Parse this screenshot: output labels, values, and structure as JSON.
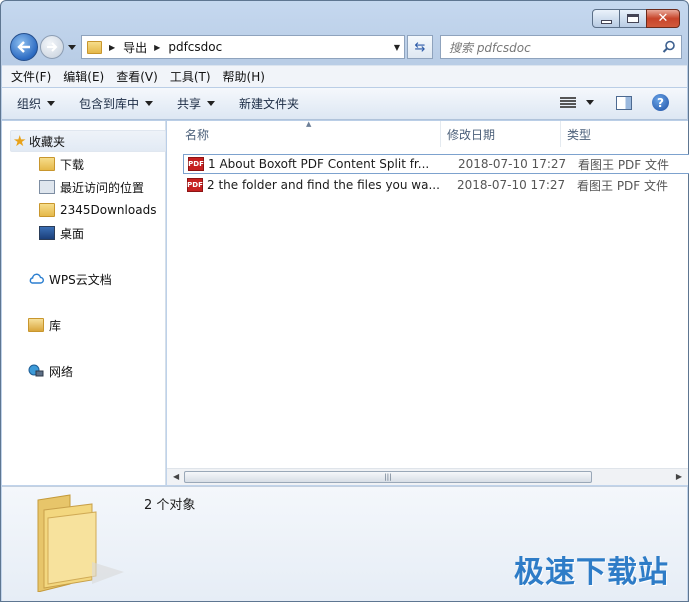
{
  "window": {
    "caption": {
      "minimize": "minimize",
      "maximize": "maximize",
      "close": "close"
    }
  },
  "navigation": {
    "address_parts": [
      "导出",
      "pdfcsdoc"
    ],
    "search_placeholder": "搜索 pdfcsdoc"
  },
  "menubar": {
    "items": [
      "文件(F)",
      "编辑(E)",
      "查看(V)",
      "工具(T)",
      "帮助(H)"
    ]
  },
  "commandbar": {
    "organize": "组织",
    "include_library": "包含到库中",
    "share": "共享",
    "new_folder": "新建文件夹"
  },
  "sidebar": {
    "favorites": "收藏夹",
    "items": [
      {
        "label": "下载",
        "icon": "download-folder-icon"
      },
      {
        "label": "最近访问的位置",
        "icon": "recent-places-icon"
      },
      {
        "label": "2345Downloads",
        "icon": "folder-icon"
      },
      {
        "label": "桌面",
        "icon": "desktop-icon"
      }
    ],
    "wps_cloud": "WPS云文档",
    "libraries": "库",
    "network": "网络"
  },
  "filelist": {
    "columns": {
      "name": "名称",
      "date": "修改日期",
      "type": "类型"
    },
    "files": [
      {
        "name": "1 About Boxoft PDF Content Split    fr...",
        "date": "2018-07-10 17:27",
        "type": "看图王 PDF 文件"
      },
      {
        "name": "2 the folder and find the files you wa...",
        "date": "2018-07-10 17:27",
        "type": "看图王 PDF 文件"
      }
    ],
    "pdf_icon_label": "PDF"
  },
  "details": {
    "count_text": "2 个对象"
  },
  "watermark": "极速下载站",
  "colors": {
    "accent": "#2e7cc7",
    "selection_border": "#7da2ce",
    "pdf_red": "#c62020"
  }
}
